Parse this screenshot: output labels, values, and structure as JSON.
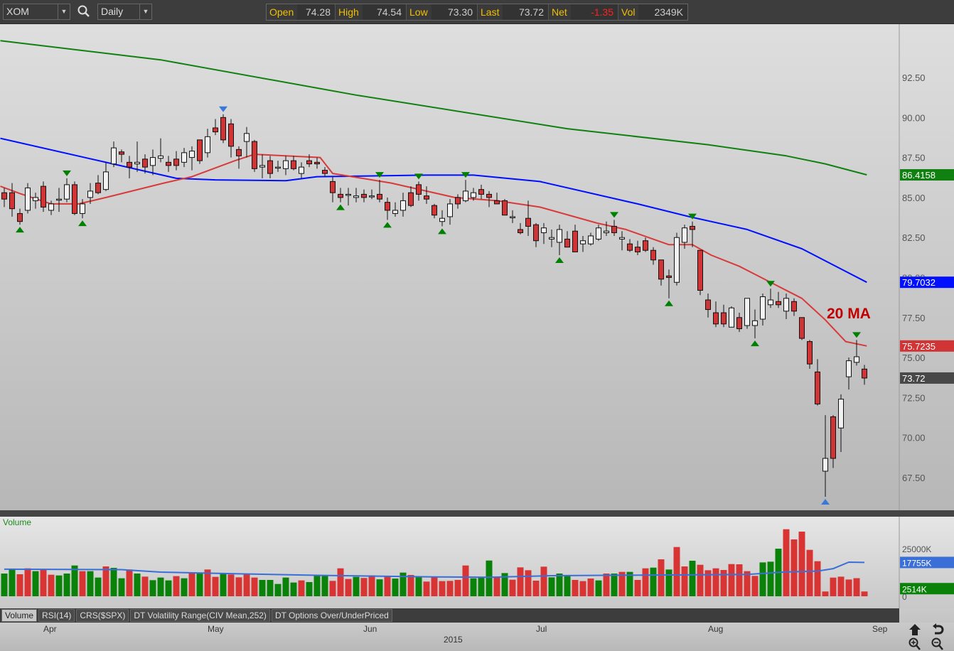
{
  "toolbar": {
    "symbol": "XOM",
    "interval": "Daily",
    "quote": [
      {
        "label": "Open",
        "value": "74.28"
      },
      {
        "label": "High",
        "value": "74.54"
      },
      {
        "label": "Low",
        "value": "73.30"
      },
      {
        "label": "Last",
        "value": "73.72"
      },
      {
        "label": "Net",
        "value": "-1.35"
      },
      {
        "label": "Vol",
        "value": "2349K"
      }
    ],
    "net_color": "#ff2020"
  },
  "tabs": [
    "Volume",
    "RSI(14)",
    "CRS($SPX)",
    "DT Volatility Range(CIV Mean,252)",
    "DT Options Over/UnderPriced"
  ],
  "active_tab": 0,
  "date_axis": {
    "months": [
      "Apr",
      "May",
      "Jun",
      "Jul",
      "Aug",
      "Sep"
    ],
    "year": "2015"
  },
  "chart_data": [
    {
      "type": "candlestick",
      "title": "XOM Daily",
      "ylim": [
        65.5,
        95.6
      ],
      "yticks": [
        "92.50",
        "90.00",
        "87.50",
        "85.00",
        "82.50",
        "80.00",
        "77.50",
        "75.00",
        "72.50",
        "70.00",
        "67.50"
      ],
      "annotation": "20 MA",
      "colors": {
        "up": "#f2f2f2",
        "down": "#d03434",
        "ma20": "#d83a3a",
        "ma50": "#0010ff",
        "ma200": "#108010",
        "pivot": "#008000",
        "extreme": "#3a78d8",
        "last": "#484848"
      },
      "ohlc": [
        [
          85.3,
          85.6,
          84.4,
          84.9
        ],
        [
          85.3,
          85.9,
          83.8,
          84.3
        ],
        [
          84.0,
          84.3,
          83.3,
          83.5
        ],
        [
          84.2,
          85.9,
          84.0,
          85.6
        ],
        [
          84.8,
          85.3,
          84.3,
          85.0
        ],
        [
          85.7,
          86.0,
          84.1,
          84.4
        ],
        [
          84.2,
          84.8,
          83.9,
          84.6
        ],
        [
          84.9,
          85.6,
          84.1,
          84.9
        ],
        [
          84.9,
          86.2,
          84.7,
          85.8
        ],
        [
          85.8,
          86.0,
          83.9,
          84.0
        ],
        [
          84.0,
          84.9,
          83.7,
          84.6
        ],
        [
          85.0,
          85.9,
          84.6,
          85.4
        ],
        [
          85.9,
          86.4,
          85.2,
          85.3
        ],
        [
          85.5,
          87.2,
          85.4,
          86.6
        ],
        [
          87.1,
          88.5,
          86.9,
          88.1
        ],
        [
          87.85,
          88.0,
          87.2,
          87.7
        ],
        [
          87.2,
          87.6,
          86.2,
          86.9
        ],
        [
          87.1,
          88.5,
          86.6,
          87.2
        ],
        [
          87.4,
          87.7,
          86.5,
          86.9
        ],
        [
          87.0,
          88.0,
          86.4,
          87.5
        ],
        [
          87.45,
          88.7,
          87.2,
          87.6
        ],
        [
          87.2,
          87.6,
          86.6,
          87.0
        ],
        [
          87.4,
          87.9,
          86.7,
          87.0
        ],
        [
          87.2,
          88.1,
          86.9,
          87.8
        ],
        [
          87.5,
          88.2,
          86.7,
          87.9
        ],
        [
          88.6,
          88.6,
          87.1,
          87.3
        ],
        [
          87.8,
          89.3,
          87.5,
          88.8
        ],
        [
          89.35,
          89.9,
          88.9,
          89.1
        ],
        [
          90.0,
          90.2,
          88.4,
          88.6
        ],
        [
          89.6,
          89.9,
          87.5,
          88.2
        ],
        [
          88.0,
          88.2,
          86.8,
          87.6
        ],
        [
          88.5,
          89.4,
          87.5,
          89.0
        ],
        [
          88.5,
          88.6,
          86.6,
          86.8
        ],
        [
          86.9,
          87.7,
          86.2,
          87.0
        ],
        [
          87.3,
          87.6,
          86.2,
          86.5
        ],
        [
          86.9,
          87.3,
          86.6,
          86.9
        ],
        [
          86.8,
          87.6,
          86.4,
          87.3
        ],
        [
          87.3,
          87.6,
          86.7,
          86.8
        ],
        [
          86.5,
          87.2,
          86.2,
          86.9
        ],
        [
          87.3,
          87.7,
          86.9,
          87.1
        ],
        [
          87.2,
          87.5,
          86.8,
          87.1
        ],
        [
          86.7,
          86.9,
          86.3,
          86.5
        ],
        [
          86.0,
          86.3,
          84.7,
          85.3
        ],
        [
          85.2,
          85.6,
          84.7,
          85.0
        ],
        [
          85.2,
          85.6,
          84.5,
          85.2
        ],
        [
          85.0,
          85.6,
          84.7,
          85.1
        ],
        [
          85.2,
          85.5,
          84.7,
          85.0
        ],
        [
          85.1,
          85.5,
          84.9,
          85.1
        ],
        [
          85.2,
          86.1,
          84.7,
          84.9
        ],
        [
          84.7,
          85.0,
          83.6,
          84.2
        ],
        [
          84.0,
          84.7,
          83.8,
          84.2
        ],
        [
          84.2,
          85.3,
          83.8,
          84.8
        ],
        [
          85.3,
          85.7,
          84.4,
          84.5
        ],
        [
          85.8,
          86.0,
          84.8,
          85.2
        ],
        [
          85.1,
          85.7,
          84.6,
          84.9
        ],
        [
          84.5,
          84.6,
          83.7,
          83.9
        ],
        [
          83.5,
          84.2,
          83.2,
          83.7
        ],
        [
          83.8,
          84.9,
          83.3,
          84.6
        ],
        [
          85.0,
          85.2,
          84.3,
          84.6
        ],
        [
          84.8,
          86.1,
          84.7,
          85.4
        ],
        [
          85.0,
          85.6,
          84.8,
          85.3
        ],
        [
          85.5,
          85.8,
          84.9,
          85.2
        ],
        [
          85.2,
          85.4,
          84.4,
          85.0
        ],
        [
          84.8,
          85.3,
          84.6,
          84.6
        ],
        [
          84.8,
          84.9,
          83.9,
          83.9
        ],
        [
          83.8,
          84.2,
          83.4,
          83.8
        ],
        [
          83.0,
          83.4,
          82.7,
          82.8
        ],
        [
          83.7,
          84.8,
          82.6,
          83.2
        ],
        [
          83.3,
          83.4,
          81.9,
          82.3
        ],
        [
          82.8,
          83.4,
          82.1,
          83.1
        ],
        [
          82.4,
          83.0,
          81.9,
          82.5
        ],
        [
          82.2,
          83.3,
          81.4,
          83.0
        ],
        [
          82.4,
          82.9,
          81.9,
          81.9
        ],
        [
          82.9,
          83.3,
          81.6,
          81.6
        ],
        [
          82.1,
          82.6,
          81.6,
          82.3
        ],
        [
          82.1,
          82.8,
          82.0,
          82.6
        ],
        [
          82.4,
          83.3,
          82.3,
          83.1
        ],
        [
          82.8,
          83.5,
          82.6,
          82.9
        ],
        [
          83.2,
          83.6,
          82.6,
          82.8
        ],
        [
          82.4,
          82.9,
          81.7,
          82.5
        ],
        [
          82.1,
          82.4,
          81.6,
          81.7
        ],
        [
          81.9,
          82.3,
          81.4,
          81.6
        ],
        [
          82.3,
          82.5,
          81.6,
          81.7
        ],
        [
          81.7,
          81.9,
          80.8,
          81.1
        ],
        [
          81.1,
          81.1,
          79.5,
          79.9
        ],
        [
          80.1,
          80.5,
          78.7,
          80.0
        ],
        [
          79.7,
          82.8,
          79.5,
          82.5
        ],
        [
          82.2,
          83.3,
          81.8,
          83.1
        ],
        [
          83.2,
          83.5,
          81.9,
          83.0
        ],
        [
          81.7,
          81.7,
          78.9,
          79.2
        ],
        [
          78.6,
          79.0,
          77.5,
          78.0
        ],
        [
          77.8,
          78.5,
          76.9,
          77.1
        ],
        [
          77.8,
          78.3,
          76.9,
          77.1
        ],
        [
          76.9,
          78.2,
          76.9,
          78.1
        ],
        [
          77.5,
          77.8,
          76.6,
          76.8
        ],
        [
          77.0,
          78.7,
          76.8,
          78.7
        ],
        [
          77.0,
          78.0,
          76.2,
          77.3
        ],
        [
          77.4,
          79.0,
          77.0,
          78.8
        ],
        [
          78.3,
          79.3,
          78.1,
          78.6
        ],
        [
          78.5,
          79.1,
          78.1,
          78.3
        ],
        [
          77.9,
          79.0,
          77.4,
          78.7
        ],
        [
          78.5,
          78.7,
          77.6,
          77.9
        ],
        [
          77.5,
          77.5,
          76.1,
          76.2
        ],
        [
          76.0,
          76.1,
          74.3,
          74.6
        ],
        [
          74.1,
          74.9,
          72.0,
          72.1
        ],
        [
          67.9,
          71.4,
          66.3,
          68.7
        ],
        [
          71.3,
          71.4,
          68.1,
          68.7
        ],
        [
          70.6,
          72.7,
          69.1,
          72.4
        ],
        [
          73.8,
          75.0,
          73.0,
          74.8
        ],
        [
          74.7,
          76.1,
          74.5,
          75.05
        ],
        [
          74.28,
          74.54,
          73.3,
          73.72
        ]
      ],
      "ma200": [
        [
          -0.5,
          94.8
        ],
        [
          20,
          93.6
        ],
        [
          45,
          91.4
        ],
        [
          72,
          89.3
        ],
        [
          90,
          88.3
        ],
        [
          100,
          87.6
        ],
        [
          105,
          87.1
        ],
        [
          110.3,
          86.4158
        ]
      ],
      "ma50": [
        [
          -0.5,
          88.7
        ],
        [
          13,
          87.2
        ],
        [
          22,
          86.2
        ],
        [
          27,
          86.1
        ],
        [
          36,
          86.05
        ],
        [
          40,
          86.3
        ],
        [
          54,
          86.4
        ],
        [
          60,
          86.4
        ],
        [
          68.5,
          86.0
        ],
        [
          81,
          84.6
        ],
        [
          87.6,
          83.8
        ],
        [
          95,
          83.0
        ],
        [
          102,
          81.8
        ],
        [
          110.3,
          79.7032
        ]
      ],
      "ma20": [
        [
          -0.5,
          85.7
        ],
        [
          2,
          85.25
        ],
        [
          6,
          84.6
        ],
        [
          9.5,
          84.6
        ],
        [
          13,
          85.0
        ],
        [
          20.4,
          85.9
        ],
        [
          24,
          86.3
        ],
        [
          29.5,
          87.3
        ],
        [
          32,
          87.7
        ],
        [
          40.4,
          87.5
        ],
        [
          42,
          86.5
        ],
        [
          49.5,
          85.9
        ],
        [
          57.6,
          85.0
        ],
        [
          63,
          84.8
        ],
        [
          68.5,
          84.4
        ],
        [
          75.8,
          83.4
        ],
        [
          79.5,
          83.0
        ],
        [
          85,
          82.05
        ],
        [
          88,
          82.05
        ],
        [
          90.4,
          81.4
        ],
        [
          94,
          80.7
        ],
        [
          97.6,
          79.8
        ],
        [
          102,
          78.7
        ],
        [
          104.9,
          77.4
        ],
        [
          107.6,
          76.0
        ],
        [
          110.3,
          75.7235
        ]
      ],
      "pivot_highs": [
        8,
        48,
        53,
        59,
        78,
        88,
        98,
        109
      ],
      "pivot_lows": [
        2,
        10,
        43,
        49,
        56,
        71,
        85,
        96
      ],
      "extreme_high": 28,
      "extreme_low": 105,
      "badges": [
        {
          "label": "86.4158",
          "value": 86.4158,
          "color": "#108010"
        },
        {
          "label": "79.7032",
          "value": 79.7032,
          "color": "#0010ff"
        },
        {
          "label": "75.7235",
          "value": 75.7235,
          "color": "#d03434"
        },
        {
          "label": "73.72",
          "value": 73.72,
          "color": "#484848"
        }
      ]
    },
    {
      "type": "bar",
      "title": "Volume",
      "unit": "K",
      "ylim": [
        0,
        36000
      ],
      "yticks": [
        {
          "label": "25000K",
          "value": 25000
        },
        {
          "label": "0",
          "value": 0
        }
      ],
      "colors": {
        "up": "#0a820a",
        "down": "#d83434",
        "ma": "#3a6fd8"
      },
      "values": [
        11930,
        14420,
        11560,
        14670,
        13180,
        14290,
        11310,
        10940,
        11930,
        16160,
        13180,
        13180,
        9820,
        15660,
        14920,
        9450,
        14050,
        11930,
        10320,
        8450,
        9820,
        8330,
        10570,
        9450,
        12430,
        11930,
        14050,
        10190,
        11930,
        11440,
        9940,
        11930,
        9820,
        8580,
        8580,
        6460,
        9820,
        7210,
        8330,
        7460,
        11190,
        10810,
        8080,
        14670,
        9070,
        10200,
        9600,
        11000,
        8900,
        10400,
        9300,
        12430,
        11190,
        10320,
        7710,
        9940,
        7960,
        8080,
        8580,
        16160,
        9450,
        9700,
        18770,
        9940,
        12180,
        8700,
        15170,
        13670,
        8200,
        15540,
        9940,
        11930,
        11190,
        8580,
        7960,
        9320,
        8330,
        11930,
        11930,
        12800,
        12800,
        8580,
        14670,
        15040,
        19390,
        14050,
        25850,
        15660,
        18650,
        16530,
        13670,
        14670,
        13800,
        16900,
        16780,
        13180,
        10690,
        17770,
        18150,
        24980,
        35180,
        29830,
        33930,
        24360,
        18400,
        2514,
        9800,
        10300,
        8800,
        9500,
        2514
      ],
      "colors_per_bar": "ggrrgrrgggrggrggrgrgggrgrgrrgrrrrgggggrgggrrrgrrgrggrgrrrrrrgggrgrrrrrgggrrrgrgrgrrgrgrrgrrrrrrrrgggr",
      "ma": [
        [
          0,
          14200
        ],
        [
          15,
          14000
        ],
        [
          20,
          12700
        ],
        [
          30,
          11800
        ],
        [
          40,
          11000
        ],
        [
          55,
          10200
        ],
        [
          62,
          10000
        ],
        [
          70,
          10800
        ],
        [
          85,
          11200
        ],
        [
          95,
          11500
        ],
        [
          100,
          12800
        ],
        [
          104,
          13200
        ],
        [
          106,
          14500
        ],
        [
          108,
          17900
        ],
        [
          110,
          17755
        ]
      ],
      "badges": [
        {
          "label": "17755K",
          "value": 17755,
          "color": "#3a6fd8"
        },
        {
          "label": "2514K",
          "value": 2514,
          "color": "#0a820a"
        }
      ]
    }
  ]
}
